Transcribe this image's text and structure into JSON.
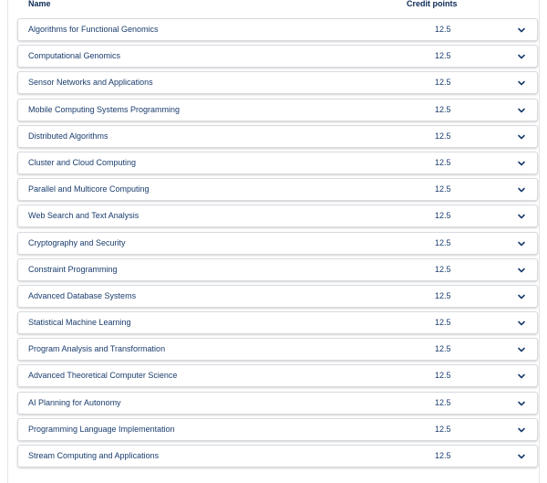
{
  "table": {
    "header": {
      "name": "Name",
      "credit_points": "Credit points"
    },
    "rows": [
      {
        "name": "Algorithms for Functional Genomics",
        "credit": "12.5"
      },
      {
        "name": "Computational Genomics",
        "credit": "12.5"
      },
      {
        "name": "Sensor Networks and Applications",
        "credit": "12.5"
      },
      {
        "name": "Mobile Computing Systems Programming",
        "credit": "12.5"
      },
      {
        "name": "Distributed Algorithms",
        "credit": "12.5"
      },
      {
        "name": "Cluster and Cloud Computing",
        "credit": "12.5"
      },
      {
        "name": "Parallel and Multicore Computing",
        "credit": "12.5"
      },
      {
        "name": "Web Search and Text Analysis",
        "credit": "12.5"
      },
      {
        "name": "Cryptography and Security",
        "credit": "12.5"
      },
      {
        "name": "Constraint Programming",
        "credit": "12.5"
      },
      {
        "name": "Advanced Database Systems",
        "credit": "12.5"
      },
      {
        "name": "Statistical Machine Learning",
        "credit": "12.5"
      },
      {
        "name": "Program Analysis and Transformation",
        "credit": "12.5"
      },
      {
        "name": "Advanced Theoretical Computer Science",
        "credit": "12.5"
      },
      {
        "name": "AI Planning for Autonomy",
        "credit": "12.5"
      },
      {
        "name": "Programming Language Implementation",
        "credit": "12.5"
      },
      {
        "name": "Stream Computing and Applications",
        "credit": "12.5"
      }
    ]
  },
  "icons": {
    "expand": "chevron-down-icon"
  },
  "colors": {
    "header_text": "#0d2a57",
    "row_text": "#1a3d6e",
    "chevron": "#1a3d6e"
  }
}
